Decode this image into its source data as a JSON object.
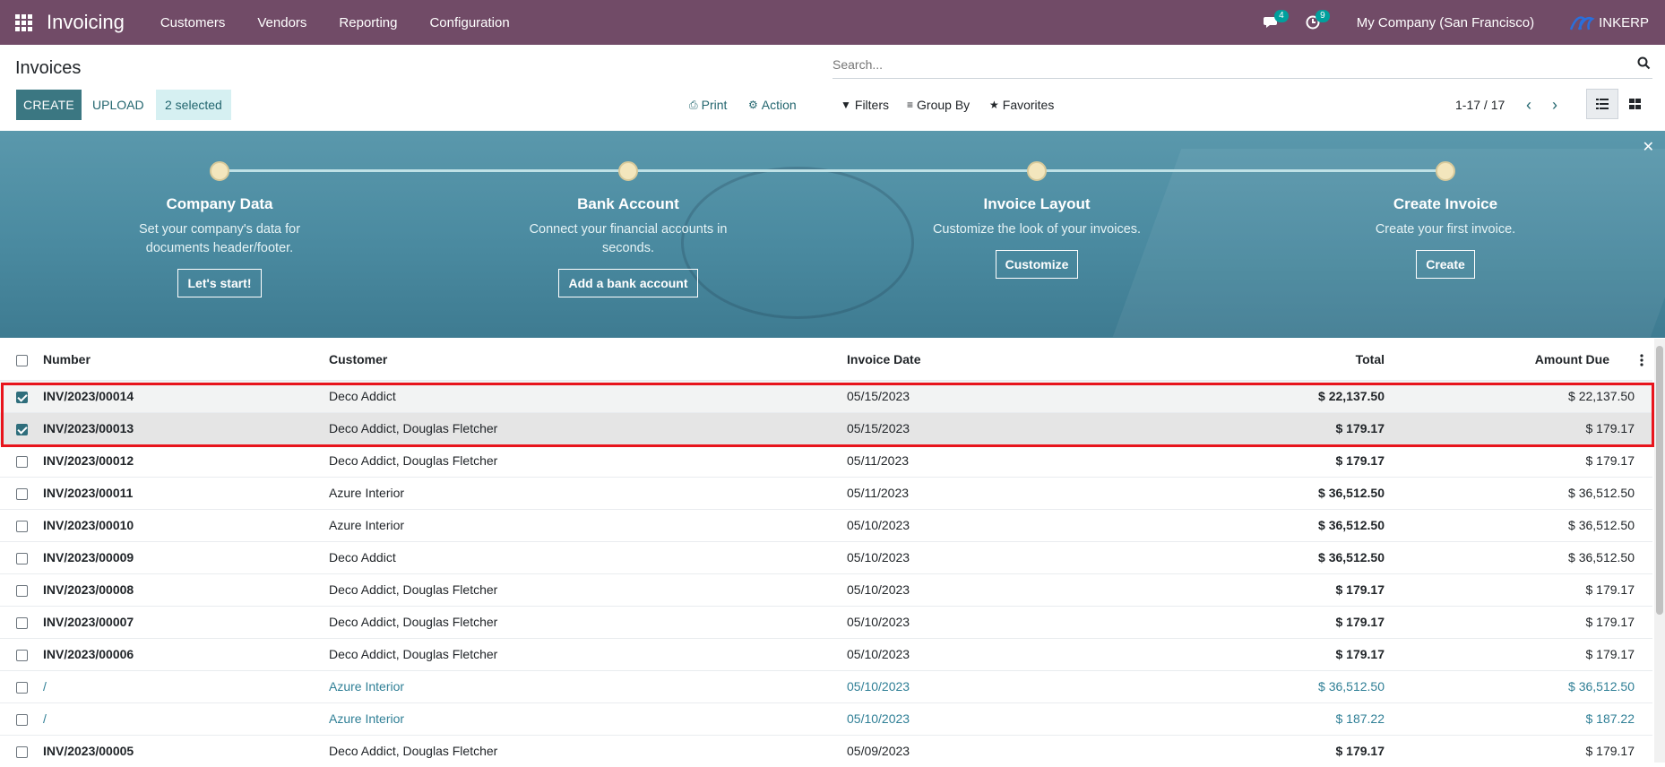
{
  "navbar": {
    "app_name": "Invoicing",
    "menu": [
      "Customers",
      "Vendors",
      "Reporting",
      "Configuration"
    ],
    "messages_count": "4",
    "activities_count": "9",
    "company": "My Company (San Francisco)",
    "brand": "INKERP"
  },
  "control_panel": {
    "breadcrumb": "Invoices",
    "search_placeholder": "Search...",
    "create_label": "CREATE",
    "upload_label": "UPLOAD",
    "selected_label": "2 selected",
    "print_label": "Print",
    "action_label": "Action",
    "filters_label": "Filters",
    "groupby_label": "Group By",
    "favorites_label": "Favorites",
    "pager": "1-17 / 17"
  },
  "banner": {
    "steps": [
      {
        "title": "Company Data",
        "desc": "Set your company's data for documents header/footer.",
        "button": "Let's start!"
      },
      {
        "title": "Bank Account",
        "desc": "Connect your financial accounts in seconds.",
        "button": "Add a bank account"
      },
      {
        "title": "Invoice Layout",
        "desc": "Customize the look of your invoices.",
        "button": "Customize"
      },
      {
        "title": "Create Invoice",
        "desc": "Create your first invoice.",
        "button": "Create"
      }
    ]
  },
  "table": {
    "headers": {
      "number": "Number",
      "customer": "Customer",
      "date": "Invoice Date",
      "total": "Total",
      "due": "Amount Due"
    },
    "rows": [
      {
        "number": "INV/2023/00014",
        "customer": "Deco Addict",
        "date": "05/15/2023",
        "total": "$ 22,137.50",
        "due": "$ 22,137.50",
        "checked": true
      },
      {
        "number": "INV/2023/00013",
        "customer": "Deco Addict, Douglas Fletcher",
        "date": "05/15/2023",
        "total": "$ 179.17",
        "due": "$ 179.17",
        "checked": true
      },
      {
        "number": "INV/2023/00012",
        "customer": "Deco Addict, Douglas Fletcher",
        "date": "05/11/2023",
        "total": "$ 179.17",
        "due": "$ 179.17",
        "checked": false
      },
      {
        "number": "INV/2023/00011",
        "customer": "Azure Interior",
        "date": "05/11/2023",
        "total": "$ 36,512.50",
        "due": "$ 36,512.50",
        "checked": false
      },
      {
        "number": "INV/2023/00010",
        "customer": "Azure Interior",
        "date": "05/10/2023",
        "total": "$ 36,512.50",
        "due": "$ 36,512.50",
        "checked": false
      },
      {
        "number": "INV/2023/00009",
        "customer": "Deco Addict",
        "date": "05/10/2023",
        "total": "$ 36,512.50",
        "due": "$ 36,512.50",
        "checked": false
      },
      {
        "number": "INV/2023/00008",
        "customer": "Deco Addict, Douglas Fletcher",
        "date": "05/10/2023",
        "total": "$ 179.17",
        "due": "$ 179.17",
        "checked": false
      },
      {
        "number": "INV/2023/00007",
        "customer": "Deco Addict, Douglas Fletcher",
        "date": "05/10/2023",
        "total": "$ 179.17",
        "due": "$ 179.17",
        "checked": false
      },
      {
        "number": "INV/2023/00006",
        "customer": "Deco Addict, Douglas Fletcher",
        "date": "05/10/2023",
        "total": "$ 179.17",
        "due": "$ 179.17",
        "checked": false
      },
      {
        "number": "/",
        "customer": "Azure Interior",
        "date": "05/10/2023",
        "total": "$ 36,512.50",
        "due": "$ 36,512.50",
        "checked": false,
        "draft": true
      },
      {
        "number": "/",
        "customer": "Azure Interior",
        "date": "05/10/2023",
        "total": "$ 187.22",
        "due": "$ 187.22",
        "checked": false,
        "draft": true
      },
      {
        "number": "INV/2023/00005",
        "customer": "Deco Addict, Douglas Fletcher",
        "date": "05/09/2023",
        "total": "$ 179.17",
        "due": "$ 179.17",
        "checked": false
      }
    ]
  },
  "colors": {
    "navbar": "#714b67",
    "primary": "#3b7782",
    "selection_frame": "#e8141c",
    "draft_text": "#2f7f96"
  }
}
